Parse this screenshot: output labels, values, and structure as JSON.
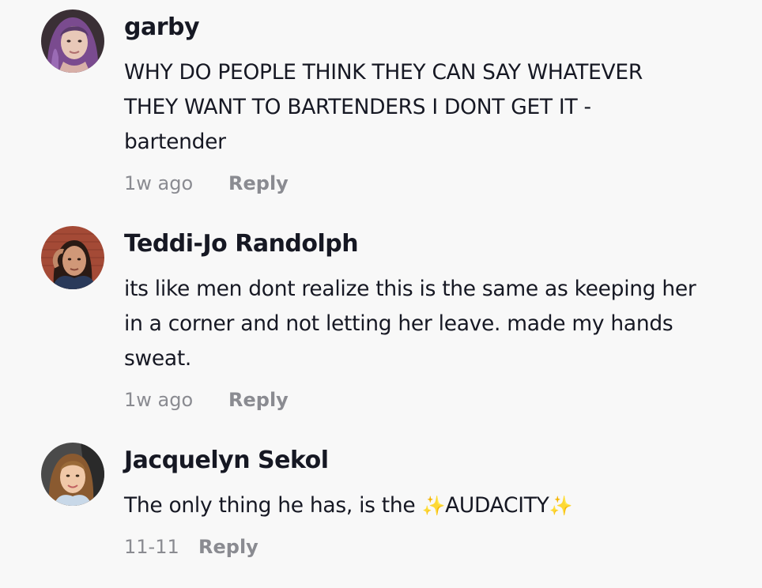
{
  "comments": [
    {
      "username": "garby",
      "text_lines": [
        "WHY DO PEOPLE THINK THEY CAN SAY WHATEVER",
        "THEY WANT TO BARTENDERS I DONT GET IT -",
        "bartender"
      ],
      "time": "1w ago",
      "reply_label": "Reply"
    },
    {
      "username": "Teddi-Jo Randolph",
      "text_lines": [
        "its like men dont realize this is the same as keeping her",
        "in a corner and not letting her leave. made my hands",
        "sweat."
      ],
      "time": "1w ago",
      "reply_label": "Reply"
    },
    {
      "username": "Jacquelyn Sekol",
      "text_before": "The only thing he has, is the ",
      "text_emph": "AUDACITY",
      "sparkle_icon": "sparkles-icon",
      "time": "11-11",
      "reply_label": "Reply"
    }
  ],
  "colors": {
    "background": "#f8f8f8",
    "text": "#161823",
    "meta": "#8a8b91",
    "sparkle": "#f7c948"
  }
}
